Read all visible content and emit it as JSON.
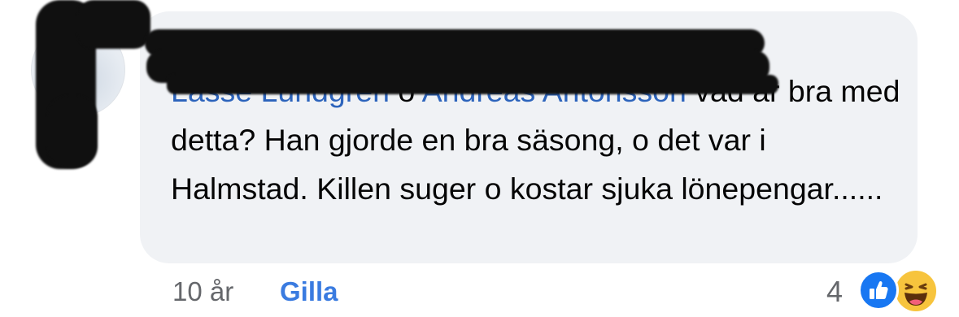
{
  "comment": {
    "author_name": "",
    "mentions": [
      "Lasse Lundgren",
      "Andreas Antonsson"
    ],
    "mention_separator": " o ",
    "body": " vad är bra med detta? Han gjorde en bra säsong, o det var i Halmstad. Killen suger o kostar sjuka lönepengar......"
  },
  "footer": {
    "time": "10 år",
    "like_label": "Gilla"
  },
  "reactions": {
    "count": "4",
    "icons": [
      "thumbs-up-icon",
      "haha-icon"
    ],
    "colors": {
      "like": "#1877f2",
      "haha": "#f7c43d"
    }
  },
  "colors": {
    "bubble": "#f0f2f5",
    "mention": "#2d64bc",
    "muted": "#65676b",
    "link": "#3a7be0"
  }
}
